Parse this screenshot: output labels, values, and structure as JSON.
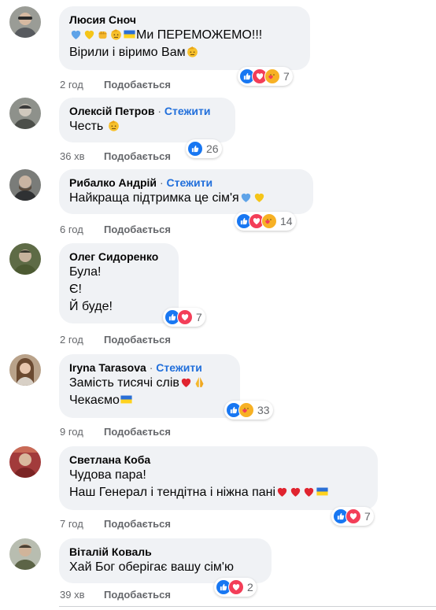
{
  "comments": [
    {
      "name": "Люсия Сноч",
      "follow": "",
      "lines": [
        "Ми ПЕРЕМОЖЕМО!!!",
        "Вірили і віримо Вам"
      ],
      "time": "2 год",
      "like_label": "Подобається",
      "reactions": [
        "like",
        "love",
        "care"
      ],
      "count": "7"
    },
    {
      "name": "Олексій Петров",
      "follow": "Стежити",
      "lines": [
        "Честь"
      ],
      "time": "36 хв",
      "like_label": "Подобається",
      "reactions": [
        "like"
      ],
      "count": "26"
    },
    {
      "name": "Рибалко Андрій",
      "follow": "Стежити",
      "lines": [
        "Найкраща підтримка це сім'я"
      ],
      "time": "6 год",
      "like_label": "Подобається",
      "reactions": [
        "like",
        "love",
        "care"
      ],
      "count": "14"
    },
    {
      "name": "Олег Сидоренко",
      "follow": "",
      "lines": [
        "Була!",
        "Є!",
        "Й буде!"
      ],
      "time": "2 год",
      "like_label": "Подобається",
      "reactions": [
        "like",
        "love"
      ],
      "count": "7"
    },
    {
      "name": "Iryna Tarasova",
      "follow": "Стежити",
      "lines": [
        "Замість тисячі слів",
        "Чекаємо"
      ],
      "time": "9 год",
      "like_label": "Подобається",
      "reactions": [
        "like",
        "care"
      ],
      "count": "33"
    },
    {
      "name": "Светлана Коба",
      "follow": "",
      "lines": [
        "Чудова пара!",
        "Наш Генерал і тендітна і ніжна пані"
      ],
      "time": "7 год",
      "like_label": "Подобається",
      "reactions": [
        "like",
        "love"
      ],
      "count": "7"
    },
    {
      "name": "Віталій Коваль",
      "follow": "",
      "lines": [
        "Хай Бог оберігає вашу сім'ю"
      ],
      "time": "39 хв",
      "like_label": "Подобається",
      "reactions": [
        "like",
        "love"
      ],
      "count": "2"
    }
  ],
  "follow_separator": "·",
  "colors": {
    "bubble": "#f0f2f5",
    "link": "#216fdb",
    "meta": "#65676b",
    "like": "#1877f2",
    "love": "#f33e58",
    "care": "#f7b125"
  }
}
